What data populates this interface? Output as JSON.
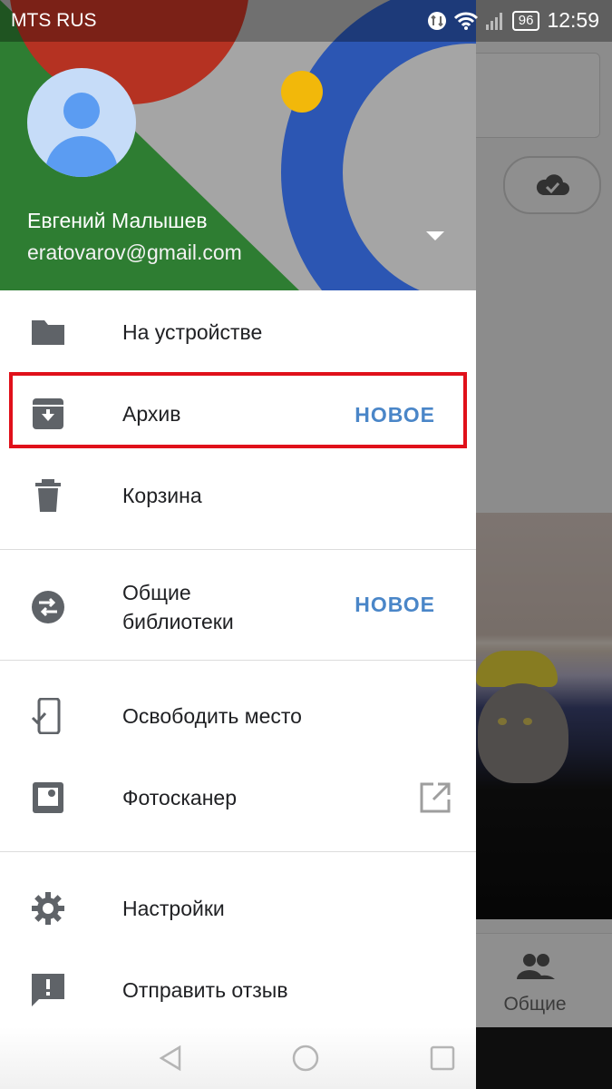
{
  "status_bar": {
    "carrier": "MTS RUS",
    "battery": "96",
    "time": "12:59",
    "icons": [
      "data-sync-icon",
      "wifi-icon",
      "signal-icon",
      "battery-icon"
    ]
  },
  "background": {
    "bottom_tab_label": "Общие"
  },
  "drawer": {
    "header": {
      "user_name": "Евгений Малышев",
      "email": "eratovarov@gmail.com"
    },
    "items": [
      {
        "label": "На устройстве",
        "icon": "folder-icon"
      },
      {
        "label": "Архив",
        "icon": "archive-icon",
        "badge": "НОВОЕ"
      },
      {
        "label": "Корзина",
        "icon": "trash-icon"
      },
      {
        "label": "Общие библиотеки",
        "icon": "shared-libraries-icon",
        "badge": "НОВОЕ"
      },
      {
        "label": "Освободить место",
        "icon": "free-up-space-icon"
      },
      {
        "label": "Фотосканер",
        "icon": "photoscan-icon"
      },
      {
        "label": "Настройки",
        "icon": "settings-icon"
      },
      {
        "label": "Отправить отзыв",
        "icon": "feedback-icon"
      }
    ]
  },
  "colors": {
    "highlight": "#e0101a",
    "badge": "#4a86c8",
    "header_green": "#2e7d32",
    "header_red": "#b53222",
    "header_blue": "#2c56b3",
    "header_yellow": "#f2b80a"
  }
}
